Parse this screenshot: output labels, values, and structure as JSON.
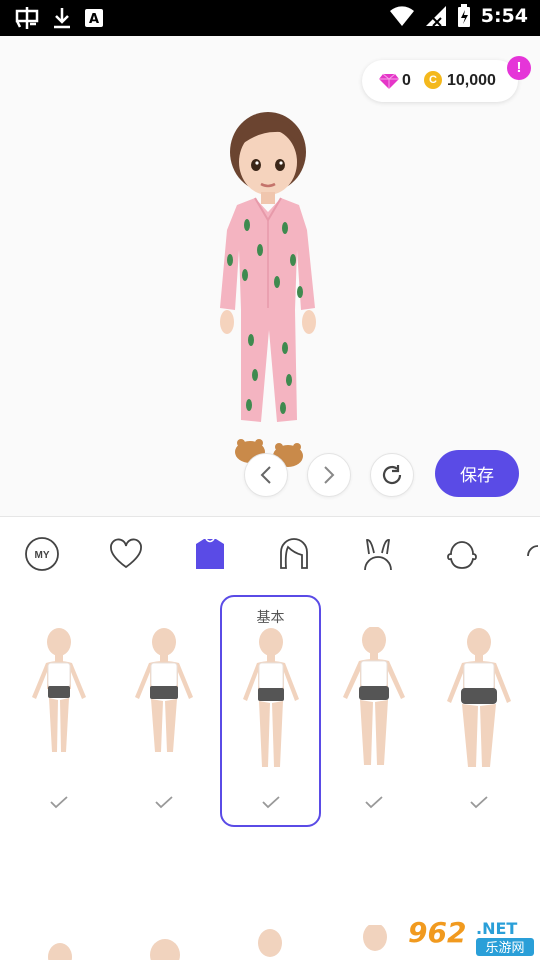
{
  "status_bar": {
    "time": "5:54",
    "left_icons": [
      "notification-app-icon",
      "download-icon",
      "text-app-icon"
    ],
    "right_icons": [
      "wifi-icon",
      "signal-icon",
      "battery-charging-icon"
    ]
  },
  "currency": {
    "gems": "0",
    "coin_letter": "C",
    "coins": "10,000",
    "alert": "!"
  },
  "controls": {
    "save_label": "保存"
  },
  "tabs": [
    {
      "name": "my",
      "label": "MY"
    },
    {
      "name": "favorites"
    },
    {
      "name": "body",
      "active": true
    },
    {
      "name": "hair"
    },
    {
      "name": "accessories"
    },
    {
      "name": "head"
    }
  ],
  "body_types": [
    {
      "label": "",
      "selected": false
    },
    {
      "label": "",
      "selected": false
    },
    {
      "label": "基本",
      "selected": true
    },
    {
      "label": "",
      "selected": false
    },
    {
      "label": "",
      "selected": false
    }
  ],
  "watermark": {
    "brand": "962",
    "tld": ".NET",
    "sub": "乐游网"
  },
  "colors": {
    "accent": "#5a4be6",
    "alert": "#e535d8",
    "coin": "#f4b81c",
    "pajama": "#f4b4c1"
  }
}
